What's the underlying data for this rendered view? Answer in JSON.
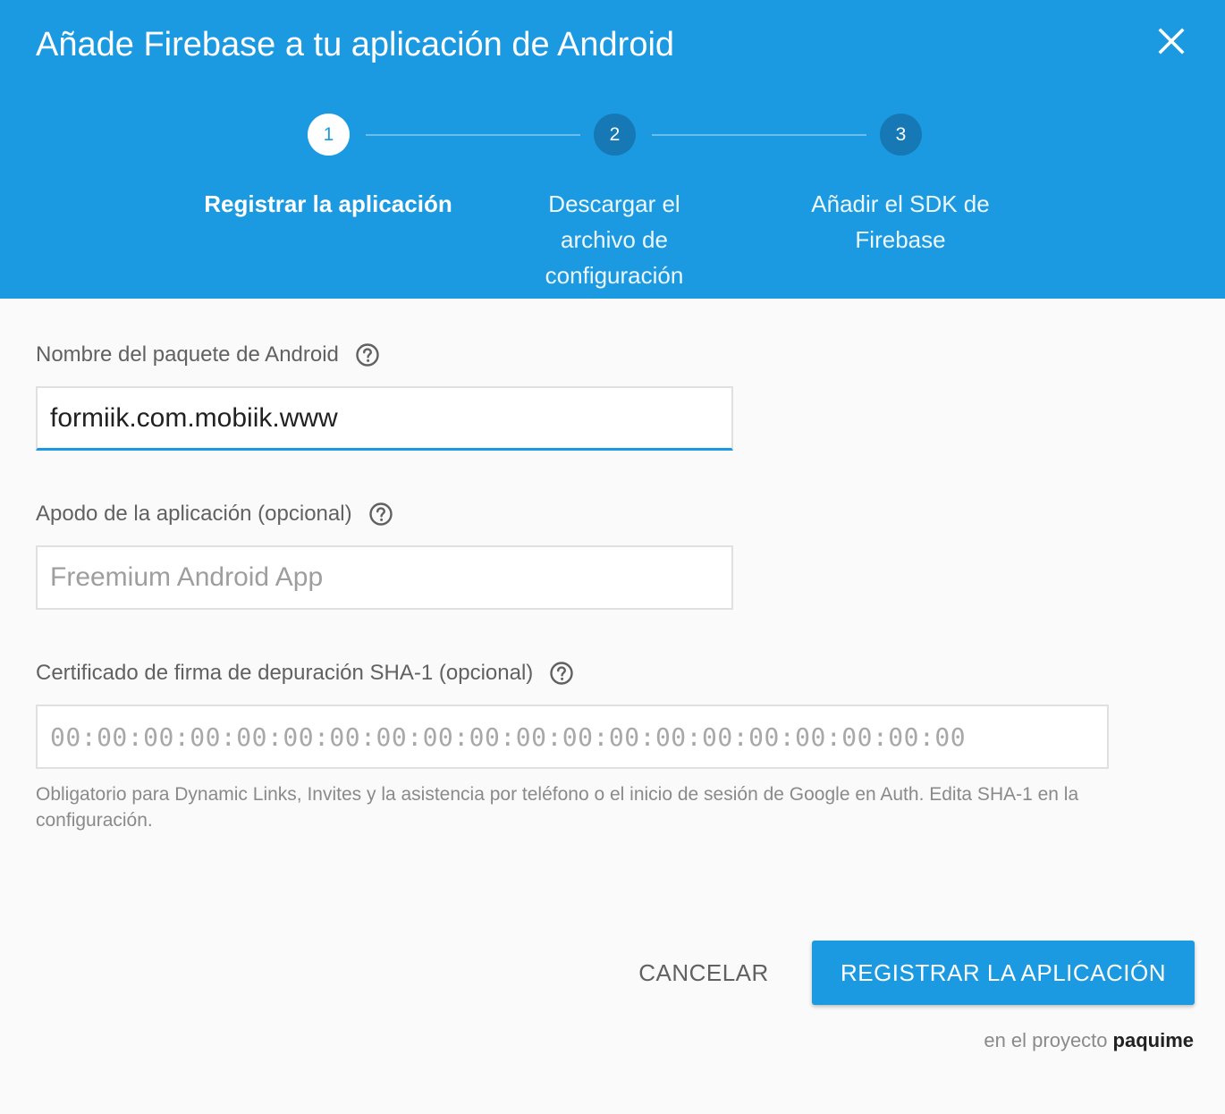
{
  "dialog": {
    "title": "Añade Firebase a tu aplicación de Android",
    "close_icon": "close-icon"
  },
  "stepper": {
    "steps": [
      {
        "number": "1",
        "label": "Registrar la aplicación",
        "state": "active"
      },
      {
        "number": "2",
        "label": "Descargar el archivo de configuración",
        "state": "inactive"
      },
      {
        "number": "3",
        "label": "Añadir el SDK de Firebase",
        "state": "inactive"
      }
    ]
  },
  "form": {
    "package_name": {
      "label": "Nombre del paquete de Android",
      "value": "formiik.com.mobiik.www",
      "help_icon": "help-circle-icon"
    },
    "app_nickname": {
      "label": "Apodo de la aplicación (opcional)",
      "placeholder": "Freemium Android App",
      "help_icon": "help-circle-icon"
    },
    "sha1": {
      "label": "Certificado de firma de depuración SHA-1 (opcional)",
      "placeholder": "00:00:00:00:00:00:00:00:00:00:00:00:00:00:00:00:00:00:00:00",
      "help_icon": "help-circle-icon",
      "hint": "Obligatorio para Dynamic Links, Invites y la asistencia por teléfono o el inicio de sesión de Google en Auth. Edita SHA-1 en la configuración."
    }
  },
  "actions": {
    "cancel_label": "CANCELAR",
    "register_label": "REGISTRAR LA APLICACIÓN"
  },
  "project": {
    "prefix": "en el proyecto",
    "name": "paquime"
  },
  "colors": {
    "header_bg": "#1c9ae1",
    "step_inactive": "#1679b5",
    "accent": "#1c9ae1"
  }
}
